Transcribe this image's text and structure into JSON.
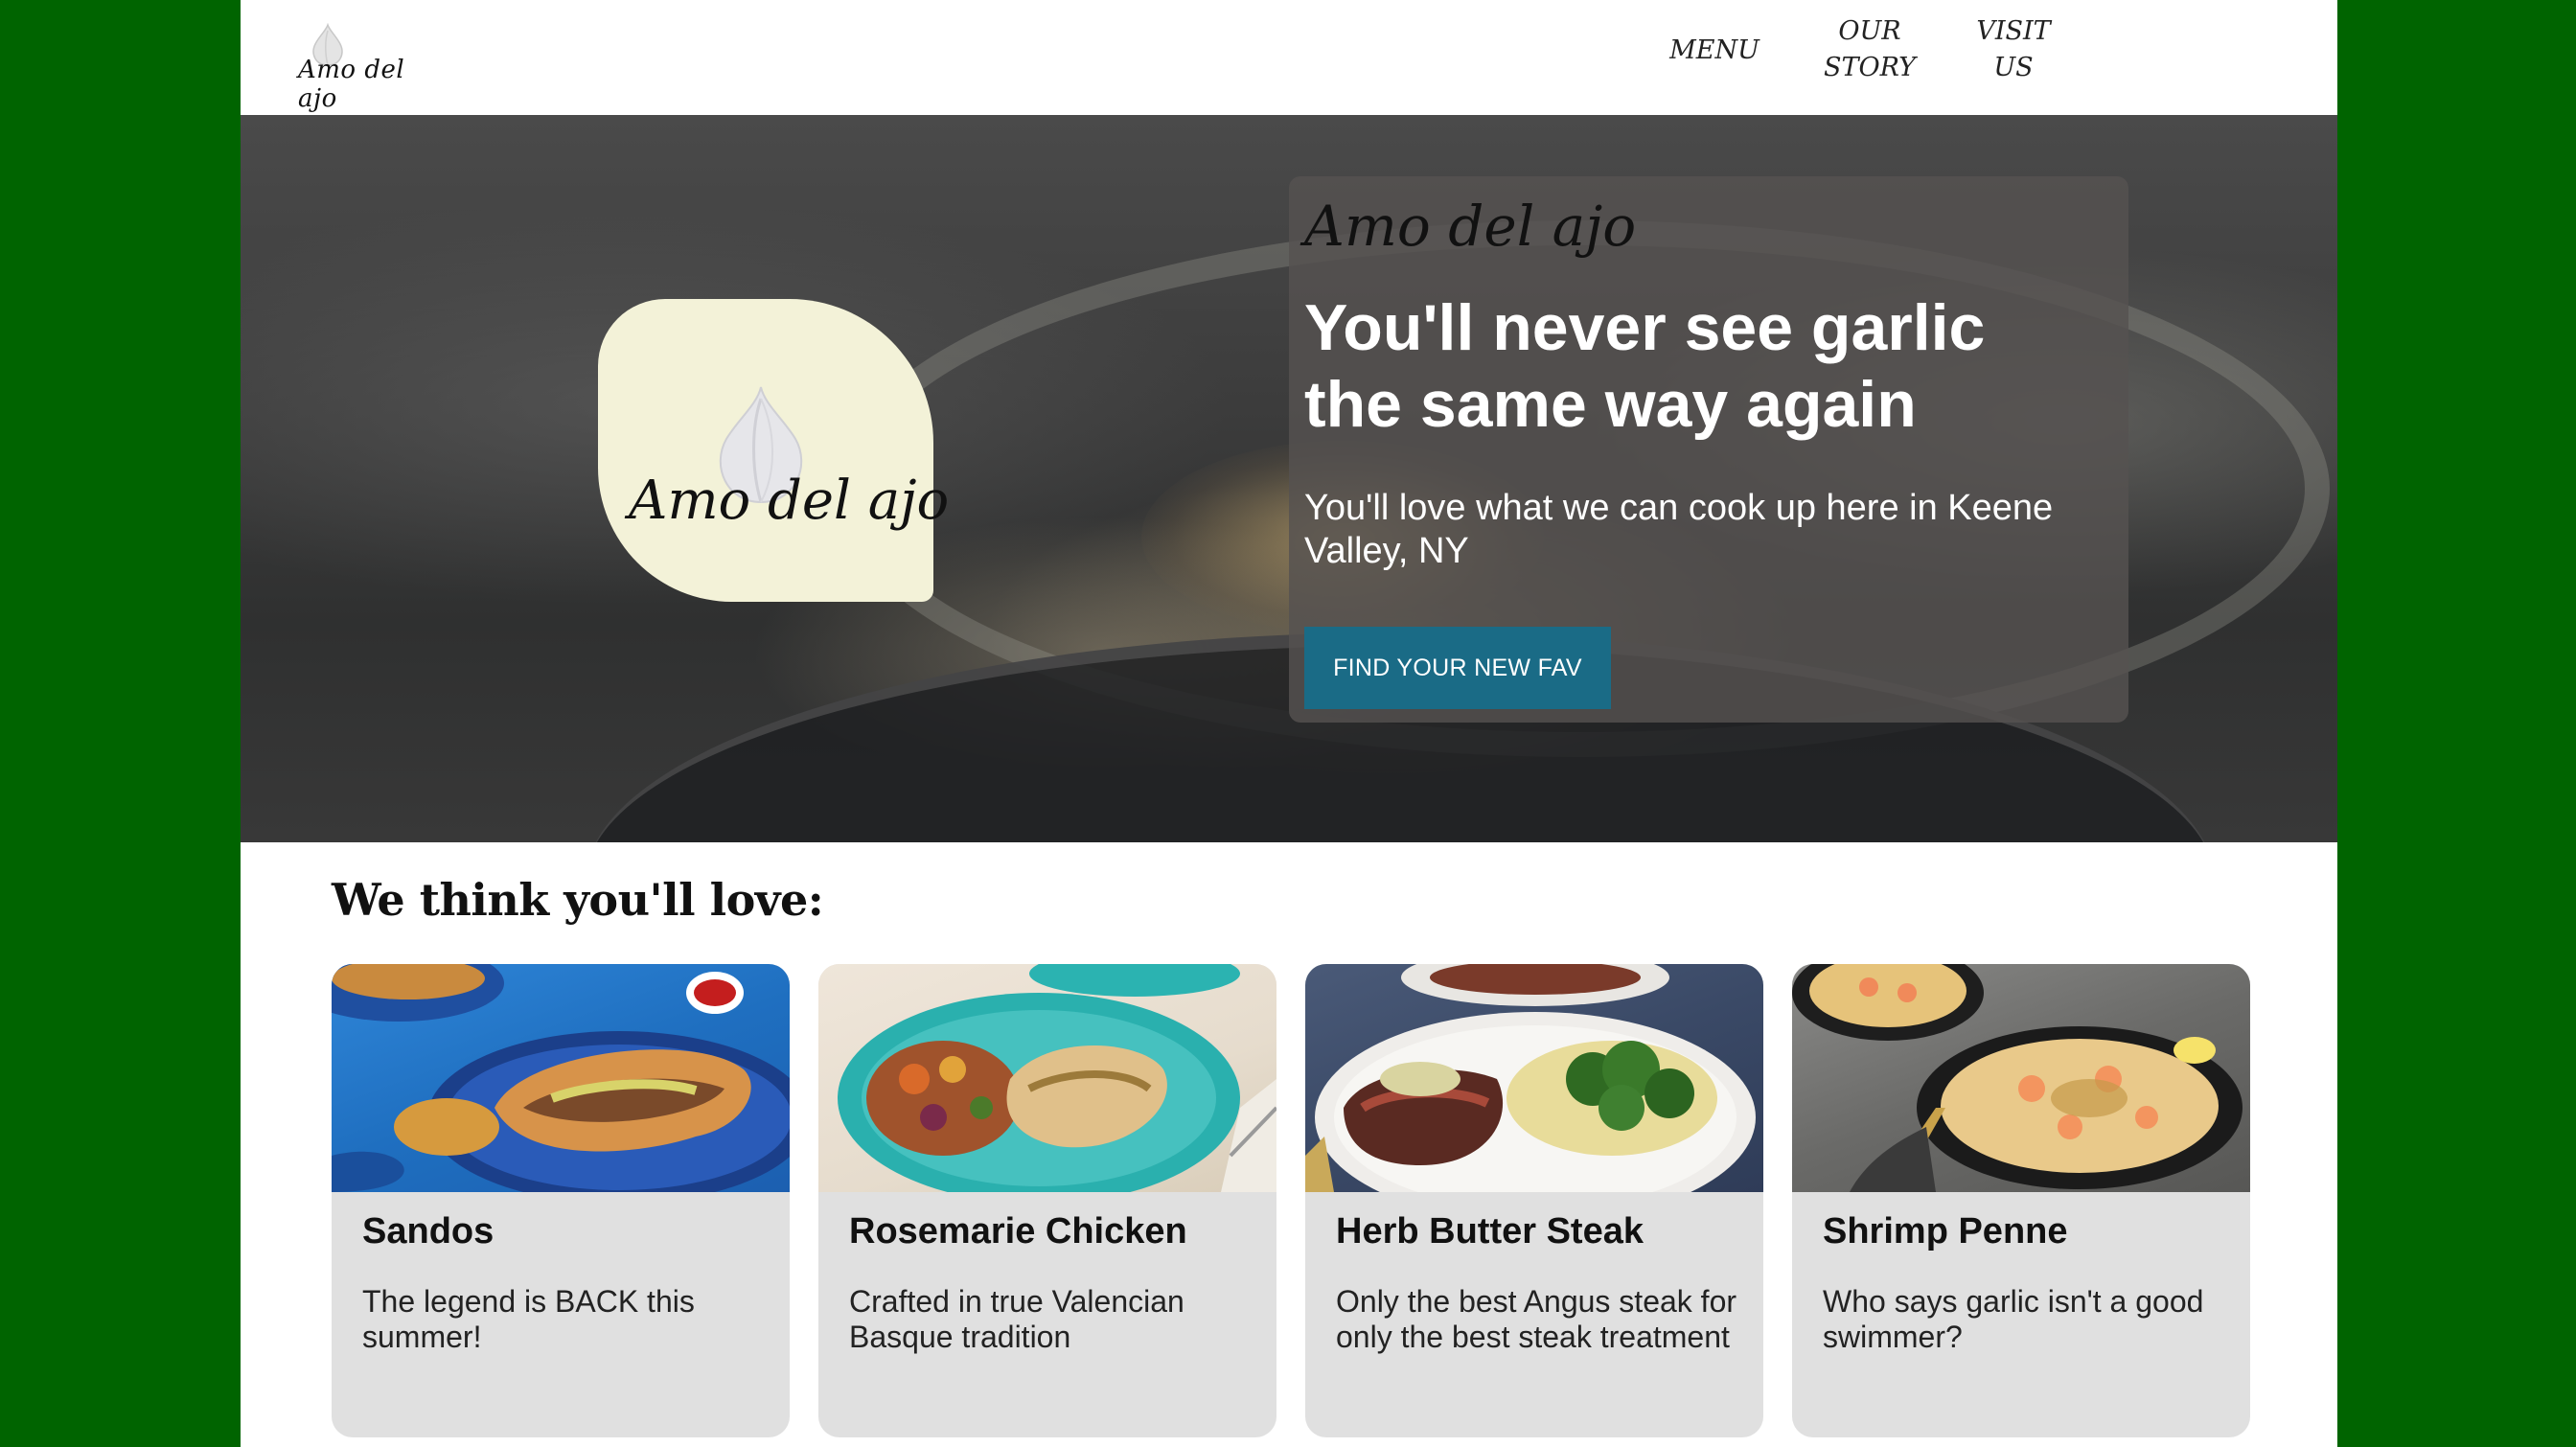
{
  "header": {
    "logo_text": "Amo del ajo",
    "nav": {
      "menu": "MENU",
      "our_story_line1": "OUR",
      "our_story_line2": "STORY",
      "visit_us_line1": "VISIT",
      "visit_us_line2": "US"
    }
  },
  "hero": {
    "logo_text": "Amo del ajo",
    "brand": "Amo del ajo",
    "headline": "You'll never see garlic the same way again",
    "subheadline": "You'll love what we can cook up here in Keene Valley, NY",
    "cta_label": "FIND YOUR NEW FAV"
  },
  "section": {
    "title": "We think you'll love:"
  },
  "cards": [
    {
      "title": "Sandos",
      "description": "The legend is BACK this summer!"
    },
    {
      "title": "Rosemarie Chicken",
      "description": "Crafted in true Valencian Basque tradition"
    },
    {
      "title": "Herb Butter Steak",
      "description": "Only the best Angus steak for only the best steak treatment"
    },
    {
      "title": "Shrimp Penne",
      "description": "Who says garlic isn't a good swimmer?"
    }
  ],
  "colors": {
    "frame_background": "#006400",
    "cta_background": "#1a6b86",
    "card_background": "#e0e0e0",
    "logo_badge": "#f3f2d8"
  }
}
